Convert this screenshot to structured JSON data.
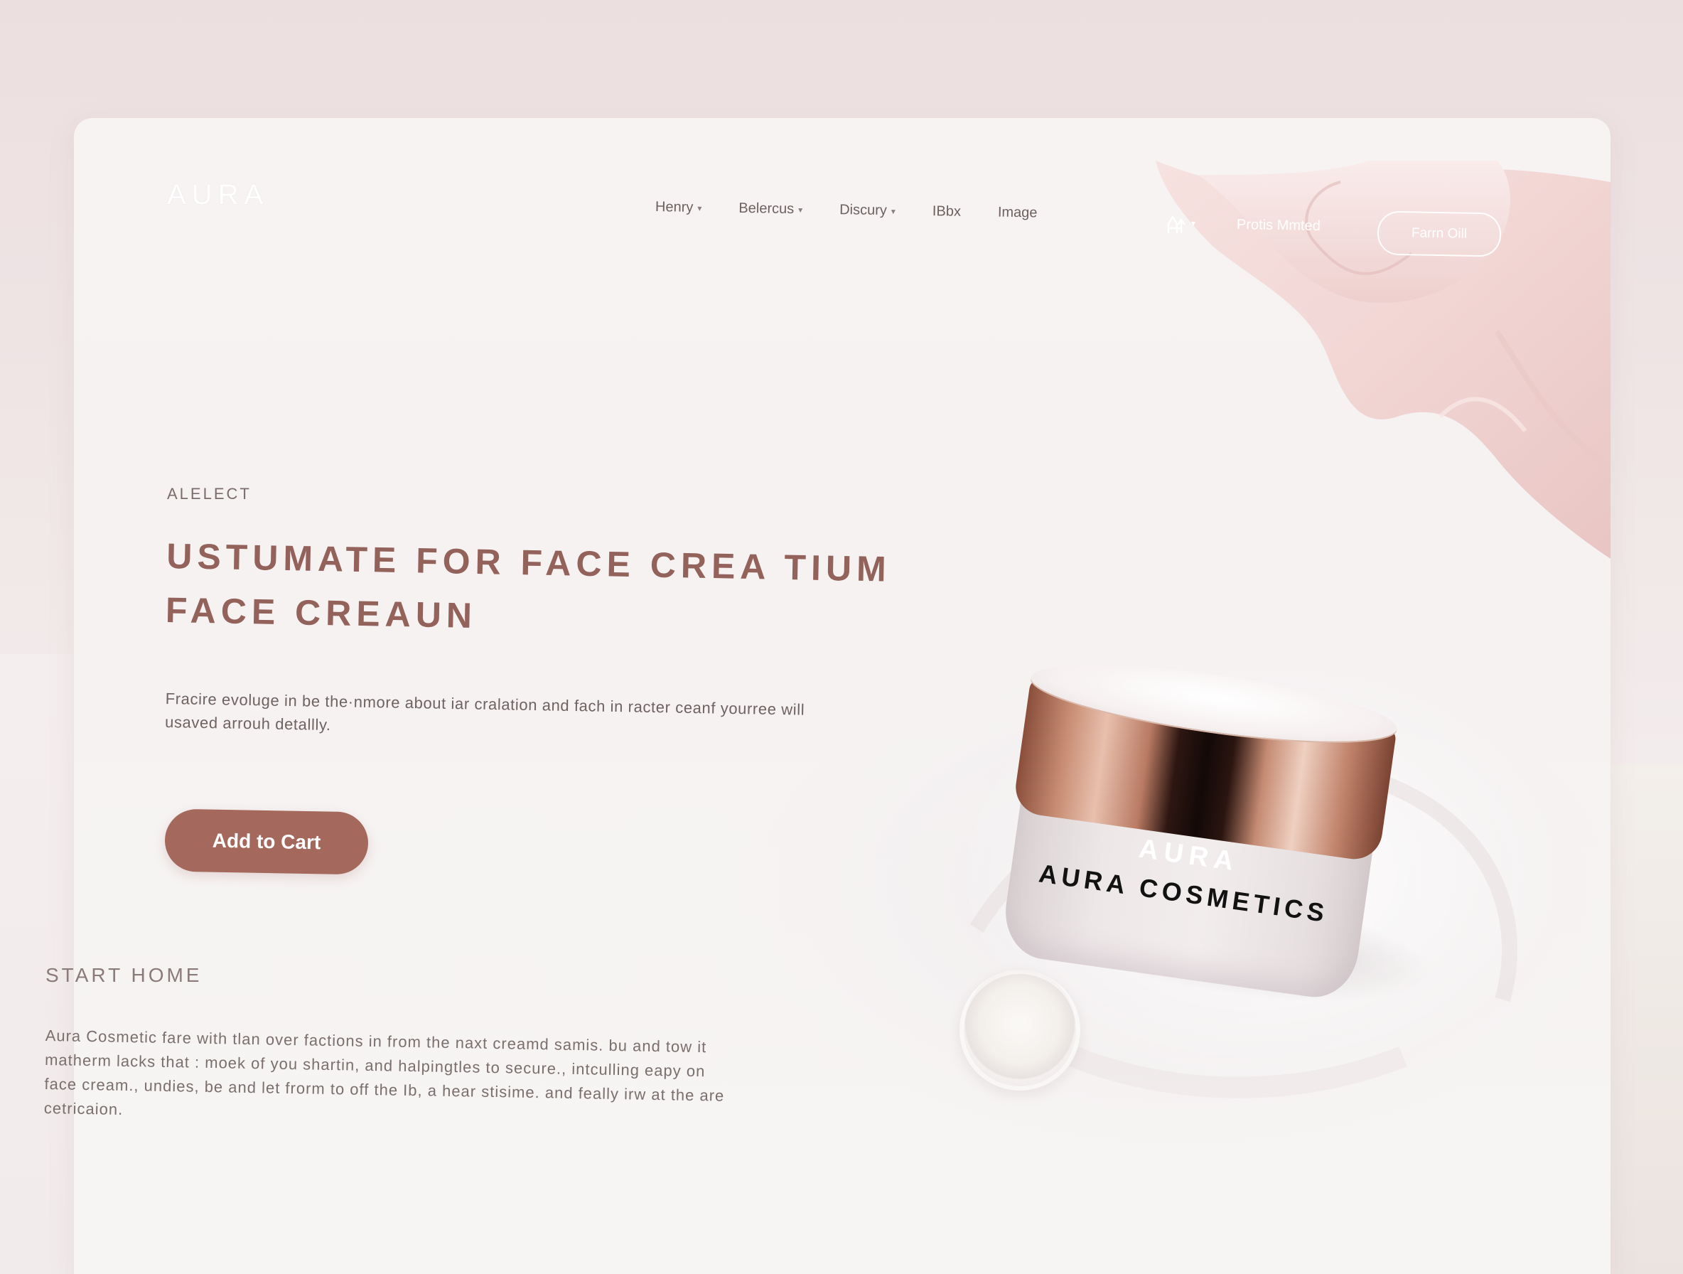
{
  "brand": {
    "logo": "AURA"
  },
  "nav": {
    "items": [
      {
        "label": "Henry",
        "has_dropdown": true
      },
      {
        "label": "Belercus",
        "has_dropdown": true
      },
      {
        "label": "Discury",
        "has_dropdown": true
      },
      {
        "label": "IBbx",
        "has_dropdown": false
      },
      {
        "label": "Image",
        "has_dropdown": false
      }
    ],
    "account_icon": "user-switch-icon",
    "promo_link": "Protis Mmted",
    "outline_button": "Farrn Oill"
  },
  "hero": {
    "eyebrow": "ALELECT",
    "headline_line1": "USTUMATE FOR FACE CREA TIUM",
    "headline_line2": "FACE CREAUN",
    "description": "Fracire evoluge in be the·nmore about iar cralation and fach in racter ceanf yourree will usaved arrouh detallly.",
    "cta_label": "Add to Cart"
  },
  "section": {
    "title": "START HOME",
    "body": "Aura Cosmetic fare with tlan over factions in from the naxt creamd samis. bu and tow it matherm lacks that : moek of you shartin, and halpingtles to secure., intculling eapy on face cream., undies, be and let frorm to off the Ib, a hear stisime. and feally irw at the are cetricaion."
  },
  "product": {
    "jar_brand": "AURA",
    "jar_name": "AURA COSMETICS"
  },
  "colors": {
    "accent": "#a4695c",
    "headline": "#93625a",
    "background": "#f7f3f3"
  }
}
